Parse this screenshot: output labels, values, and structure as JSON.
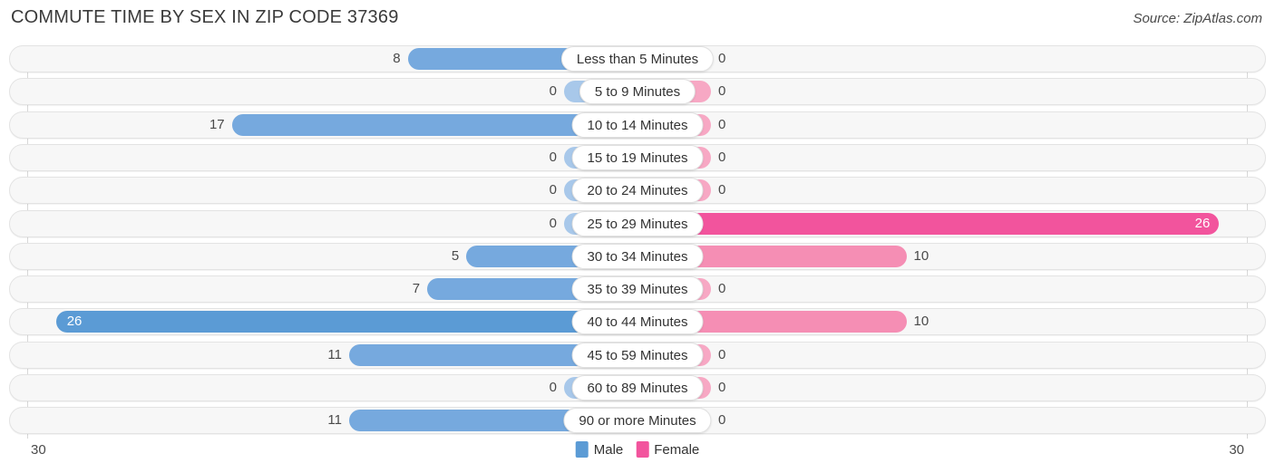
{
  "title": "COMMUTE TIME BY SEX IN ZIP CODE 37369",
  "source": "Source: ZipAtlas.com",
  "axis": {
    "left": "30",
    "right": "30"
  },
  "legend": {
    "male": {
      "label": "Male",
      "color": "#5B9BD5"
    },
    "female": {
      "label": "Female",
      "color": "#F2549D"
    }
  },
  "colors": {
    "male_max": "#5B9BD5",
    "male_mid": "#76A9DE",
    "male_low": "#A8C8EA",
    "female_max": "#F2549D",
    "female_mid": "#F58EB4",
    "female_low": "#F7A8C4"
  },
  "chart_data": {
    "type": "bar",
    "title": "COMMUTE TIME BY SEX IN ZIP CODE 37369",
    "xlabel": "",
    "ylabel": "",
    "orientation": "horizontal-diverging",
    "xlim": [
      30,
      30
    ],
    "grid": true,
    "legend_position": "bottom-center",
    "categories": [
      "Less than 5 Minutes",
      "5 to 9 Minutes",
      "10 to 14 Minutes",
      "15 to 19 Minutes",
      "20 to 24 Minutes",
      "25 to 29 Minutes",
      "30 to 34 Minutes",
      "35 to 39 Minutes",
      "40 to 44 Minutes",
      "45 to 59 Minutes",
      "60 to 89 Minutes",
      "90 or more Minutes"
    ],
    "series": [
      {
        "name": "Male",
        "values": [
          8,
          0,
          17,
          0,
          0,
          0,
          5,
          7,
          26,
          11,
          0,
          11
        ]
      },
      {
        "name": "Female",
        "values": [
          0,
          0,
          0,
          0,
          0,
          26,
          10,
          0,
          10,
          0,
          0,
          0
        ]
      }
    ]
  },
  "rows": [
    {
      "label": "Less than 5 Minutes",
      "male": "8",
      "female": "0"
    },
    {
      "label": "5 to 9 Minutes",
      "male": "0",
      "female": "0"
    },
    {
      "label": "10 to 14 Minutes",
      "male": "17",
      "female": "0"
    },
    {
      "label": "15 to 19 Minutes",
      "male": "0",
      "female": "0"
    },
    {
      "label": "20 to 24 Minutes",
      "male": "0",
      "female": "0"
    },
    {
      "label": "25 to 29 Minutes",
      "male": "0",
      "female": "26"
    },
    {
      "label": "30 to 34 Minutes",
      "male": "5",
      "female": "10"
    },
    {
      "label": "35 to 39 Minutes",
      "male": "7",
      "female": "0"
    },
    {
      "label": "40 to 44 Minutes",
      "male": "26",
      "female": "10"
    },
    {
      "label": "45 to 59 Minutes",
      "male": "11",
      "female": "0"
    },
    {
      "label": "60 to 89 Minutes",
      "male": "0",
      "female": "0"
    },
    {
      "label": "90 or more Minutes",
      "male": "11",
      "female": "0"
    }
  ]
}
